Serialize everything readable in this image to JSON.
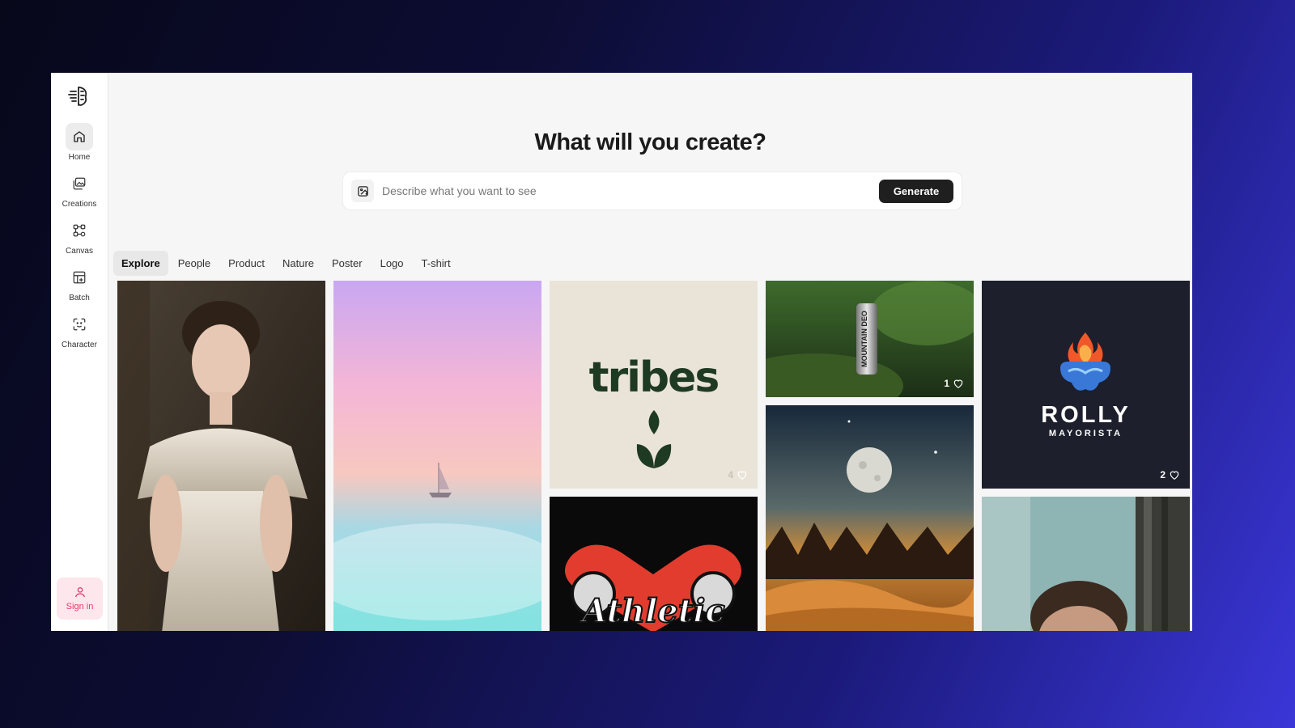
{
  "sidebar": {
    "logo_icon": "brain-logo-icon",
    "items": [
      {
        "label": "Home",
        "icon": "home-icon",
        "active": true
      },
      {
        "label": "Creations",
        "icon": "images-icon",
        "active": false
      },
      {
        "label": "Canvas",
        "icon": "canvas-nodes-icon",
        "active": false
      },
      {
        "label": "Batch",
        "icon": "batch-grid-icon",
        "active": false
      },
      {
        "label": "Character",
        "icon": "face-scan-icon",
        "active": false
      }
    ],
    "signin_label": "Sign in"
  },
  "main": {
    "headline": "What will you create?",
    "prompt": {
      "placeholder": "Describe what you want to see",
      "value": "",
      "generate_label": "Generate"
    },
    "tabs": [
      {
        "label": "Explore",
        "active": true
      },
      {
        "label": "People",
        "active": false
      },
      {
        "label": "Product",
        "active": false
      },
      {
        "label": "Nature",
        "active": false
      },
      {
        "label": "Poster",
        "active": false
      },
      {
        "label": "Logo",
        "active": false
      },
      {
        "label": "T-shirt",
        "active": false
      }
    ]
  },
  "gallery": {
    "tribes": {
      "text": "tribes",
      "likes": "4"
    },
    "can": {
      "text": "MOUNTAIN DEO",
      "likes": "1"
    },
    "rolly": {
      "title": "ROLLY",
      "subtitle": "MAYORISTA",
      "likes": "2"
    },
    "athletic": {
      "text": "Athletic"
    }
  },
  "colors": {
    "accent_pink": "#e23a6a",
    "button_dark": "#1f1f1f",
    "bg_gradient_end": "#3a36d8"
  }
}
